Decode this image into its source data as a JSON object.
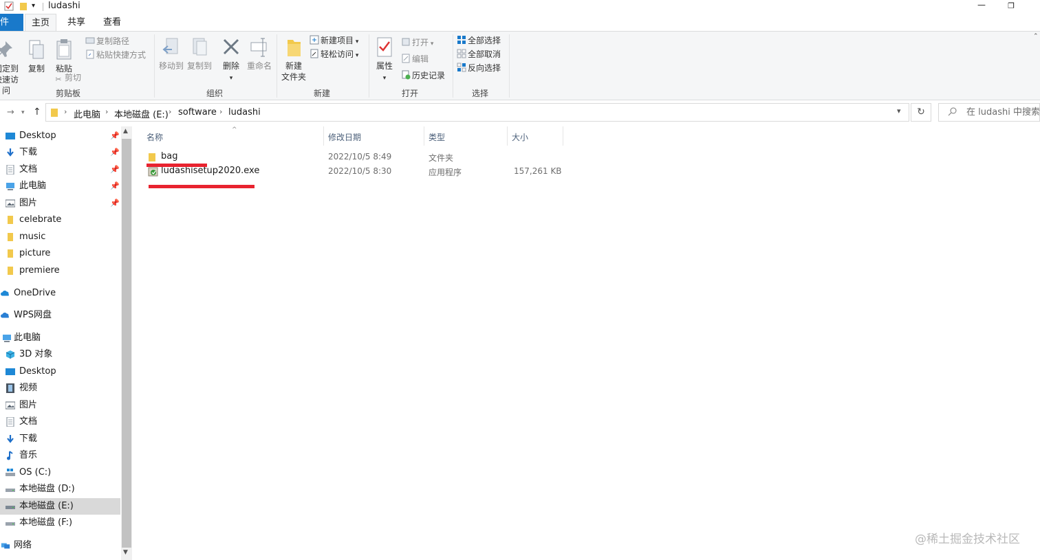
{
  "window": {
    "title": "ludashi",
    "minimize": "—",
    "restore": "❐"
  },
  "tabs": {
    "file": "文件",
    "home": "主页",
    "share": "共享",
    "view": "查看"
  },
  "ribbon": {
    "clipboard": {
      "label": "剪贴板",
      "pin_line1": "固定到",
      "pin_line2": "快速访问",
      "copy": "复制",
      "paste": "粘贴",
      "copy_path": "复制路径",
      "paste_shortcut": "粘贴快捷方式",
      "cut": "剪切"
    },
    "organize": {
      "label": "组织",
      "move_to": "移动到",
      "copy_to": "复制到",
      "delete": "删除",
      "rename": "重命名"
    },
    "new": {
      "label": "新建",
      "new_folder_line1": "新建",
      "new_folder_line2": "文件夹",
      "new_item": "新建项目",
      "easy_access": "轻松访问"
    },
    "open": {
      "label": "打开",
      "properties": "属性",
      "open": "打开",
      "edit": "编辑",
      "history": "历史记录"
    },
    "select": {
      "label": "选择",
      "select_all": "全部选择",
      "select_none": "全部取消",
      "invert": "反向选择"
    }
  },
  "address": {
    "crumbs": [
      "此电脑",
      "本地磁盘 (E:)",
      "software",
      "ludashi"
    ],
    "search_placeholder": "在 ludashi 中搜索"
  },
  "nav": {
    "quick_access": [
      {
        "label": "Desktop",
        "icon": "desktop-icon",
        "pinned": true
      },
      {
        "label": "下载",
        "icon": "download-icon",
        "pinned": true
      },
      {
        "label": "文档",
        "icon": "document-icon",
        "pinned": true
      },
      {
        "label": "此电脑",
        "icon": "computer-icon",
        "pinned": true
      },
      {
        "label": "图片",
        "icon": "picture-icon",
        "pinned": true
      },
      {
        "label": "celebrate",
        "icon": "folder-icon",
        "pinned": false
      },
      {
        "label": "music",
        "icon": "folder-icon",
        "pinned": false
      },
      {
        "label": "picture",
        "icon": "folder-icon",
        "pinned": false
      },
      {
        "label": "premiere",
        "icon": "folder-icon",
        "pinned": false
      }
    ],
    "onedrive": "OneDrive",
    "wps": "WPS网盘",
    "this_pc": "此电脑",
    "pc_items": [
      {
        "label": "3D 对象",
        "icon": "3d-objects-icon"
      },
      {
        "label": "Desktop",
        "icon": "desktop-icon"
      },
      {
        "label": "视频",
        "icon": "video-icon"
      },
      {
        "label": "图片",
        "icon": "picture-icon"
      },
      {
        "label": "文档",
        "icon": "document-icon"
      },
      {
        "label": "下载",
        "icon": "download-icon"
      },
      {
        "label": "音乐",
        "icon": "music-icon"
      },
      {
        "label": "OS (C:)",
        "icon": "os-drive-icon"
      },
      {
        "label": "本地磁盘 (D:)",
        "icon": "drive-icon"
      },
      {
        "label": "本地磁盘 (E:)",
        "icon": "drive-icon",
        "selected": true
      },
      {
        "label": "本地磁盘 (F:)",
        "icon": "drive-icon"
      }
    ],
    "network": "网络"
  },
  "files": {
    "columns": {
      "name": "名称",
      "modified": "修改日期",
      "type": "类型",
      "size": "大小"
    },
    "rows": [
      {
        "name": "bag",
        "modified": "2022/10/5 8:49",
        "type": "文件夹",
        "size": ""
      },
      {
        "name": "ludashisetup2020.exe",
        "modified": "2022/10/5 8:30",
        "type": "应用程序",
        "size": "157,261 KB"
      }
    ]
  },
  "watermark": "@稀土掘金技术社区",
  "colors": {
    "accent": "#1979ca",
    "folder": "#f2c94c",
    "annotation": "#e8232f"
  }
}
